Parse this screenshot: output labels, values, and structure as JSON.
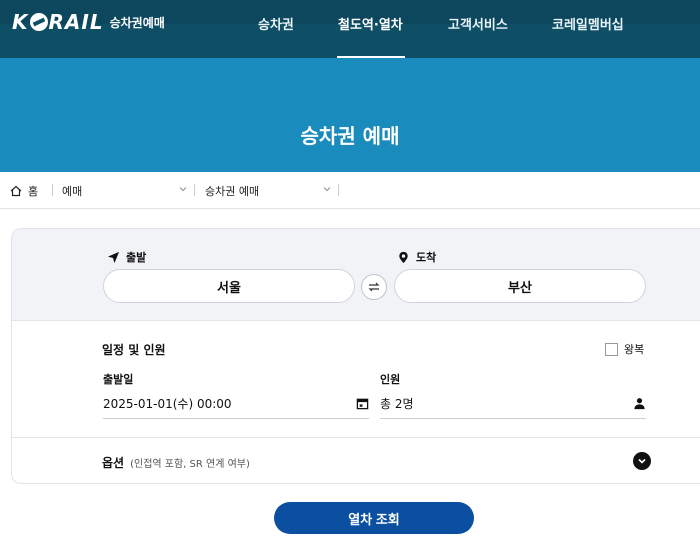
{
  "header": {
    "logo_text": "KORAIL",
    "logo_sub": "승차권예매",
    "nav": [
      "승차권",
      "철도역·열차",
      "고객서비스",
      "코레일멤버십"
    ],
    "active_nav": "철도역·열차",
    "bg_color": "#0f4f66"
  },
  "hero": {
    "title": "승차권 예매",
    "bg_color": "#1a8bbd"
  },
  "breadcrumb": {
    "home": "홈",
    "level1": "예매",
    "level2": "승차권 예매"
  },
  "booking": {
    "departure_label": "출발",
    "departure_value": "서울",
    "arrival_label": "도착",
    "arrival_value": "부산",
    "schedule_title": "일정 및 인원",
    "roundtrip_label": "왕복",
    "roundtrip_checked": false,
    "date_label": "출발일",
    "date_value": "2025-01-01(수) 00:00",
    "passengers_label": "인원",
    "passengers_value": "총 2명",
    "options_label": "옵션",
    "options_desc": "(인접역 포함, SR 연계 여부)"
  },
  "search_button": "열차 조회",
  "accent_color": "#0b4fa0",
  "icons": [
    "home-icon",
    "chevron-down-icon",
    "navigation-arrow-icon",
    "location-pin-icon",
    "swap-icon",
    "calendar-icon",
    "person-icon",
    "chevron-circle-down-icon"
  ]
}
